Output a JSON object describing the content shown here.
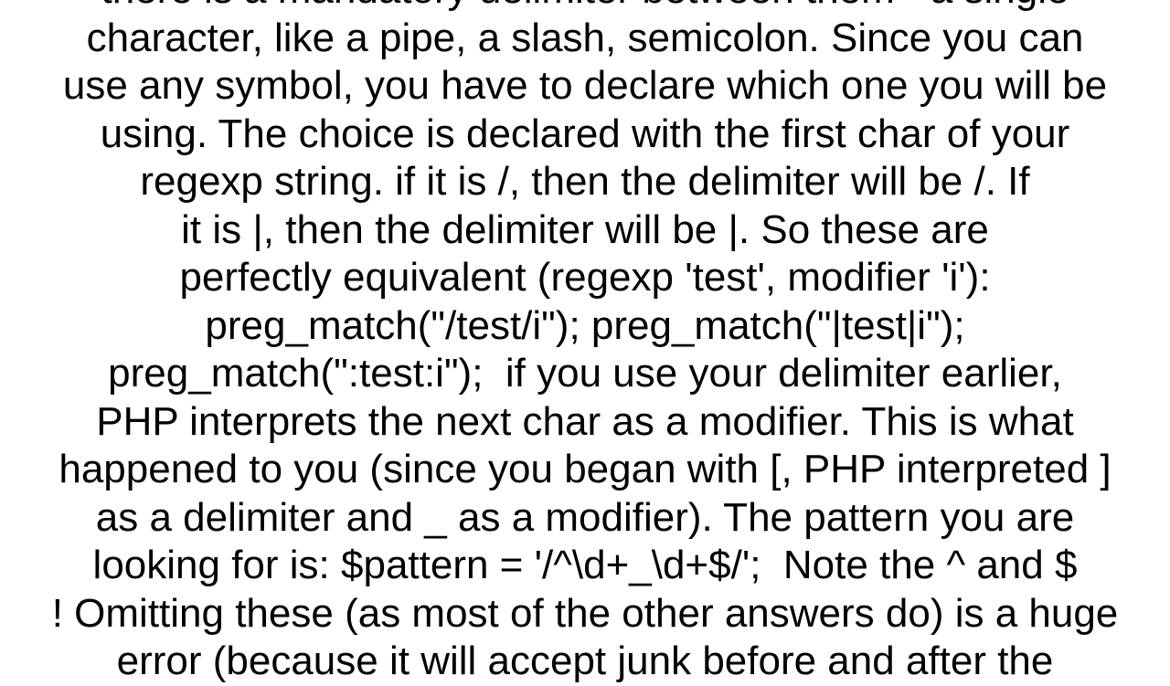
{
  "document": {
    "text_color": "#000000",
    "background_color": "#ffffff",
    "lines": [
      "there is a mandatory delimiter between them - a single",
      "character, like a pipe, a slash, semicolon. Since you can",
      "use any symbol, you have to declare which one you will be",
      "using. The choice is declared with the first char of your",
      "regexp string. if it is /, then the delimiter will be /. If",
      "it is |, then the delimiter will be |. So these are",
      "perfectly equivalent (regexp 'test', modifier 'i'):",
      "preg_match(\"/test/i\"); preg_match(\"|test|i\");",
      "preg_match(\":test:i\");  if you use your delimiter earlier,",
      "PHP interprets the next char as a modifier. This is what",
      "happened to you (since you began with [, PHP interpreted ]",
      "as a delimiter and _ as a modifier). The pattern you are",
      "looking for is: $pattern = '/^\\d+_\\d+$/';  Note the ^ and $",
      "! Omitting these (as most of the other answers do) is a huge",
      "error (because it will accept junk before and after the"
    ]
  }
}
